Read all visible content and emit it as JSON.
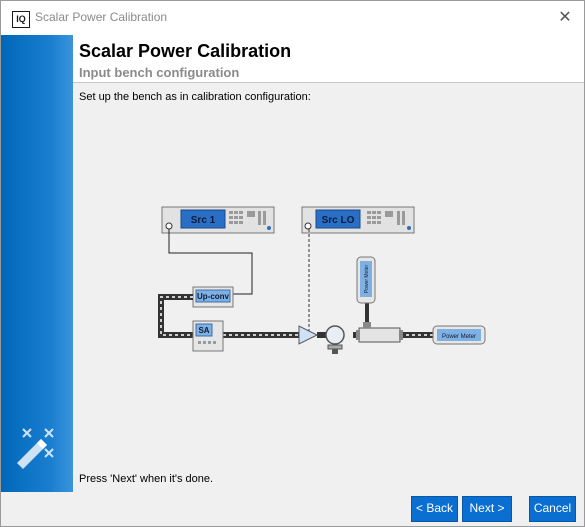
{
  "window": {
    "title": "Scalar Power Calibration",
    "app_icon_text": "IQ",
    "close_glyph": "✕"
  },
  "header": {
    "title": "Scalar Power Calibration",
    "subtitle": "Input bench configuration"
  },
  "instruction": "Set up the bench as in calibration configuration:",
  "diagram": {
    "src1_label": "Src 1",
    "srclo_label": "Src LO",
    "upconv_label": "Up-conv",
    "sa_label": "SA",
    "power_meter_vertical": "Power Meter",
    "power_meter_horizontal": "Power Meter"
  },
  "footer_text": "Press 'Next' when it's done.",
  "buttons": {
    "back": "< Back",
    "next": "Next >",
    "cancel": "Cancel"
  },
  "colors": {
    "accent": "#0a6fd0",
    "sidebar": "#0067b8",
    "instrument_screen": "#2a6fc6"
  },
  "icons": {
    "sidebar": "magic-wand-icon",
    "close": "close-icon"
  }
}
